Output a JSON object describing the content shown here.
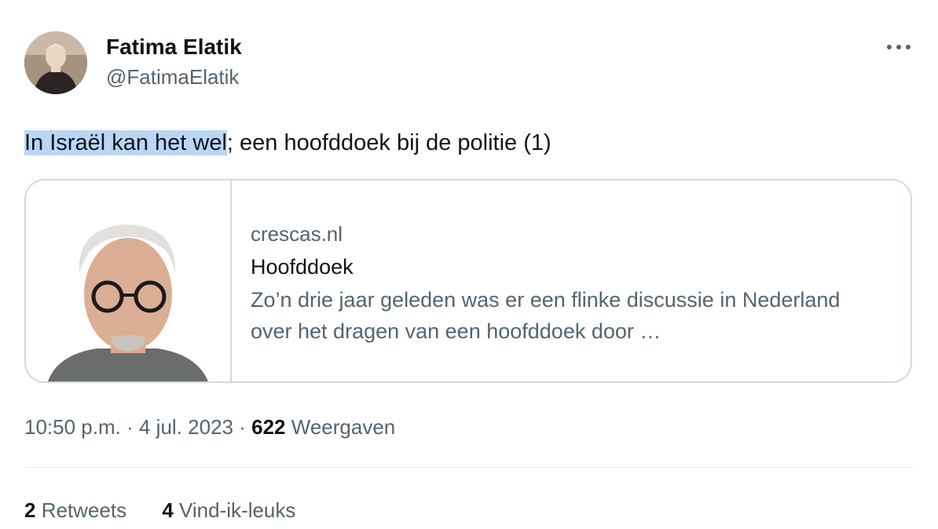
{
  "author": {
    "display_name": "Fatima Elatik",
    "handle": "@FatimaElatik"
  },
  "tweet": {
    "text_highlighted": "In Israël kan het wel",
    "text_rest": "; een hoofddoek bij de politie (1)"
  },
  "link_card": {
    "domain": "crescas.nl",
    "title": "Hoofddoek",
    "description": "Zo’n drie jaar geleden was er een flinke discussie in Nederland over het dragen van een hoofddoek door …"
  },
  "meta": {
    "time": "10:50 p.m.",
    "separator": "·",
    "date": "4 jul. 2023",
    "views_count": "622",
    "views_label": "Weergaven"
  },
  "stats": {
    "retweets_count": "2",
    "retweets_label": "Retweets",
    "likes_count": "4",
    "likes_label": "Vind-ik-leuks"
  },
  "colors": {
    "highlight": "#b9d7f5",
    "text_primary": "#0f1419",
    "text_secondary": "#536471",
    "border": "#cfd9de"
  },
  "icons": {
    "more": "more-options-icon"
  }
}
